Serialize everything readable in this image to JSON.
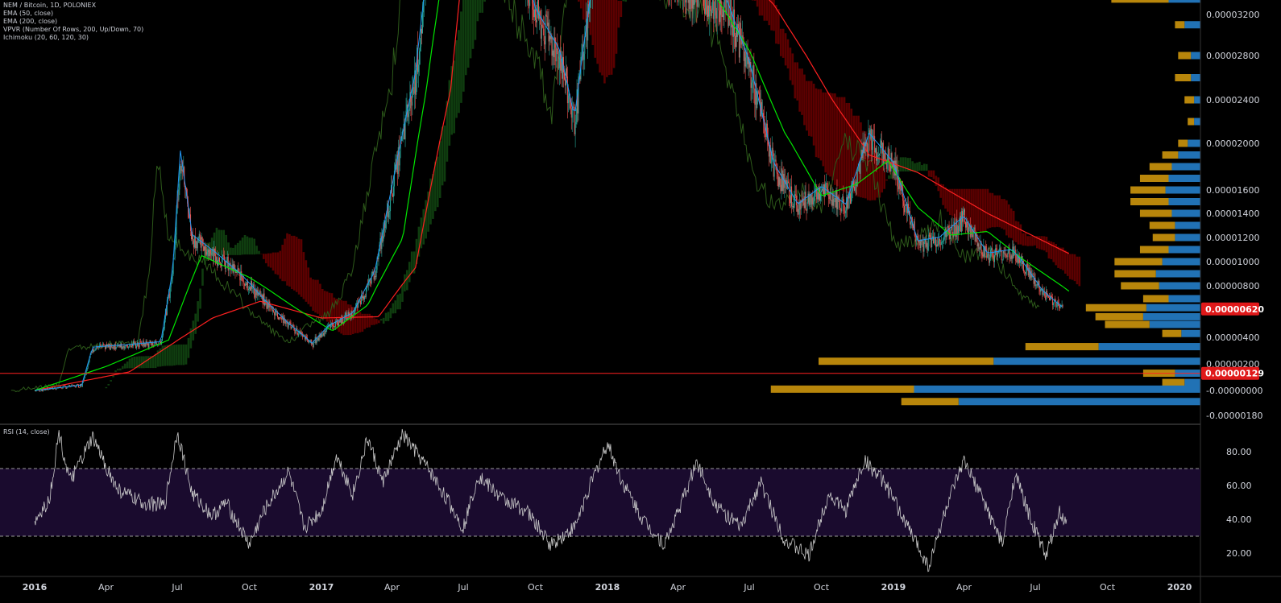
{
  "legend": {
    "symbol": "NEM / Bitcoin, 1D, POLONIEX",
    "ema50": "EMA (50, close)",
    "ema200": "EMA (200, close)",
    "vpvr": "VPVR (Number Of Rows, 200, Up/Down, 70)",
    "ichimoku": "Ichimoku (20, 60, 120, 30)",
    "rsi": "RSI (14, close)"
  },
  "colors": {
    "background": "#000000",
    "candle_up": "#26a69a",
    "candle_down": "#ef5350",
    "ema50": "#00e600",
    "ema200": "#ff2020",
    "tenkan": "#2196f3",
    "kumo_bear": "#5c0000",
    "kumo_bull": "#0f3d0f",
    "chikou": "#2d5a1a",
    "vpvr_up": "#2172b5",
    "vpvr_down": "#b8860b",
    "rsi_line": "#c8c8c8",
    "rsi_band": "#1a0b2e",
    "price_badge": "#e0191a"
  },
  "chart_data": [
    {
      "type": "candlestick",
      "pair": "NEM / Bitcoin",
      "interval": "1D",
      "exchange": "POLONIEX",
      "x_tick_labels": [
        "2016",
        "Apr",
        "Jul",
        "Oct",
        "2017",
        "Apr",
        "Jul",
        "Oct",
        "2018",
        "Apr",
        "Jul",
        "Oct",
        "2019",
        "Apr",
        "Jul",
        "Oct",
        "2020"
      ],
      "y_tick_labels": [
        "0.00003200",
        "0.00002800",
        "0.00002400",
        "0.00002000",
        "0.00001600",
        "0.00001400",
        "0.00001200",
        "0.00001000",
        "0.00000800",
        "0.00000400",
        "0.00000200",
        "-0.00000000",
        "-0.00000180"
      ],
      "y_tick_values": [
        3.2e-05,
        2.8e-05,
        2.4e-05,
        2e-05,
        1.6e-05,
        1.4e-05,
        1.2e-05,
        1e-05,
        8e-06,
        4e-06,
        2e-06,
        0,
        -1.8e-06
      ],
      "last_price_label": "0.00000620",
      "last_price": 6.2e-06,
      "horizontal_line_label": "0.00000129",
      "horizontal_line": 1.29e-06,
      "close_path": [
        [
          "2016-01-01",
          0.0
        ],
        [
          "2016-03-01",
          4e-07
        ],
        [
          "2016-03-15",
          3.2e-06
        ],
        [
          "2016-05-01",
          3.4e-06
        ],
        [
          "2016-06-10",
          3.6e-06
        ],
        [
          "2016-06-25",
          9e-06
        ],
        [
          "2016-07-05",
          1.9e-05
        ],
        [
          "2016-07-20",
          1.2e-05
        ],
        [
          "2016-08-20",
          1.05e-05
        ],
        [
          "2016-09-20",
          8.8e-06
        ],
        [
          "2016-10-20",
          6.8e-06
        ],
        [
          "2016-11-20",
          5e-06
        ],
        [
          "2016-12-20",
          3.5e-06
        ],
        [
          "2017-01-10",
          4.8e-06
        ],
        [
          "2017-02-10",
          5.8e-06
        ],
        [
          "2017-03-10",
          9e-06
        ],
        [
          "2017-04-01",
          1.6e-05
        ],
        [
          "2017-05-01",
          2.6e-05
        ],
        [
          "2017-05-15",
          3.5e-05
        ],
        [
          "2017-07-01",
          6e-05
        ],
        [
          "2017-10-01",
          3.2e-05
        ],
        [
          "2017-11-01",
          2.8e-05
        ],
        [
          "2017-11-20",
          2.2e-05
        ],
        [
          "2017-12-10",
          3.3e-05
        ],
        [
          "2018-01-10",
          6e-05
        ],
        [
          "2018-03-15",
          3.6e-05
        ],
        [
          "2018-05-01",
          3.4e-05
        ],
        [
          "2018-06-01",
          3.3e-05
        ],
        [
          "2018-07-01",
          2.7e-05
        ],
        [
          "2018-08-01",
          1.8e-05
        ],
        [
          "2018-09-01",
          1.45e-05
        ],
        [
          "2018-10-01",
          1.6e-05
        ],
        [
          "2018-11-01",
          1.45e-05
        ],
        [
          "2018-12-01",
          2.05e-05
        ],
        [
          "2019-01-01",
          1.8e-05
        ],
        [
          "2019-02-01",
          1.15e-05
        ],
        [
          "2019-03-01",
          1.18e-05
        ],
        [
          "2019-04-01",
          1.35e-05
        ],
        [
          "2019-05-01",
          1.05e-05
        ],
        [
          "2019-06-01",
          1.08e-05
        ],
        [
          "2019-06-15",
          9.8e-06
        ],
        [
          "2019-07-10",
          7.5e-06
        ],
        [
          "2019-08-05",
          6.2e-06
        ]
      ],
      "ema50_path": [
        [
          "2016-01-01",
          0.0
        ],
        [
          "2016-04-01",
          1.8e-06
        ],
        [
          "2016-06-20",
          3.8e-06
        ],
        [
          "2016-08-01",
          1.05e-05
        ],
        [
          "2016-10-01",
          8.7e-06
        ],
        [
          "2016-12-01",
          6.2e-06
        ],
        [
          "2017-01-15",
          4.5e-06
        ],
        [
          "2017-03-01",
          6.5e-06
        ],
        [
          "2017-04-15",
          1.2e-05
        ],
        [
          "2017-05-15",
          2.5e-05
        ],
        [
          "2017-07-01",
          5e-05
        ],
        [
          "2018-05-01",
          3.6e-05
        ],
        [
          "2018-07-01",
          2.85e-05
        ],
        [
          "2018-08-15",
          2.1e-05
        ],
        [
          "2018-10-01",
          1.55e-05
        ],
        [
          "2018-11-15",
          1.65e-05
        ],
        [
          "2018-12-25",
          1.85e-05
        ],
        [
          "2019-02-01",
          1.45e-05
        ],
        [
          "2019-03-15",
          1.22e-05
        ],
        [
          "2019-05-01",
          1.25e-05
        ],
        [
          "2019-06-15",
          1.02e-05
        ],
        [
          "2019-08-15",
          7.5e-06
        ]
      ],
      "ema200_path": [
        [
          "2016-01-01",
          0.0
        ],
        [
          "2016-05-01",
          1.4e-06
        ],
        [
          "2016-08-15",
          5.5e-06
        ],
        [
          "2016-10-15",
          6.8e-06
        ],
        [
          "2017-01-01",
          5.5e-06
        ],
        [
          "2017-03-15",
          5.6e-06
        ],
        [
          "2017-05-01",
          9.5e-06
        ],
        [
          "2017-06-15",
          2.5e-05
        ],
        [
          "2017-07-15",
          4.8e-05
        ],
        [
          "2018-05-01",
          4e-05
        ],
        [
          "2018-08-01",
          3.3e-05
        ],
        [
          "2018-10-15",
          2.4e-05
        ],
        [
          "2018-12-01",
          1.9e-05
        ],
        [
          "2019-02-01",
          1.75e-05
        ],
        [
          "2019-05-01",
          1.4e-05
        ],
        [
          "2019-08-15",
          1.06e-05
        ]
      ],
      "rsi": {
        "period": 14,
        "y_tick_labels": [
          "80.00",
          "60.00",
          "40.00",
          "20.00"
        ],
        "y_tick_values": [
          80,
          60,
          40,
          20
        ],
        "overbought": 70,
        "oversold": 30,
        "path": [
          [
            "2016-01-01",
            38
          ],
          [
            "2016-01-20",
            52
          ],
          [
            "2016-02-01",
            91
          ],
          [
            "2016-02-15",
            62
          ],
          [
            "2016-03-15",
            88
          ],
          [
            "2016-04-15",
            58
          ],
          [
            "2016-05-15",
            50
          ],
          [
            "2016-06-15",
            48
          ],
          [
            "2016-07-01",
            92
          ],
          [
            "2016-07-20",
            55
          ],
          [
            "2016-08-15",
            42
          ],
          [
            "2016-09-01",
            50
          ],
          [
            "2016-10-01",
            25
          ],
          [
            "2016-10-20",
            45
          ],
          [
            "2016-11-20",
            68
          ],
          [
            "2016-12-10",
            35
          ],
          [
            "2017-01-01",
            45
          ],
          [
            "2017-01-20",
            78
          ],
          [
            "2017-02-10",
            55
          ],
          [
            "2017-03-01",
            88
          ],
          [
            "2017-03-20",
            62
          ],
          [
            "2017-04-15",
            90
          ],
          [
            "2017-05-20",
            68
          ],
          [
            "2017-06-15",
            48
          ],
          [
            "2017-07-01",
            35
          ],
          [
            "2017-07-20",
            66
          ],
          [
            "2017-08-20",
            52
          ],
          [
            "2017-09-20",
            45
          ],
          [
            "2017-10-20",
            25
          ],
          [
            "2017-11-20",
            35
          ],
          [
            "2017-12-10",
            60
          ],
          [
            "2018-01-01",
            85
          ],
          [
            "2018-01-20",
            62
          ],
          [
            "2018-02-15",
            40
          ],
          [
            "2018-03-15",
            25
          ],
          [
            "2018-04-10",
            55
          ],
          [
            "2018-04-25",
            74
          ],
          [
            "2018-05-20",
            48
          ],
          [
            "2018-06-20",
            35
          ],
          [
            "2018-07-15",
            62
          ],
          [
            "2018-08-15",
            28
          ],
          [
            "2018-09-15",
            18
          ],
          [
            "2018-10-10",
            55
          ],
          [
            "2018-11-01",
            45
          ],
          [
            "2018-11-25",
            75
          ],
          [
            "2018-12-20",
            62
          ],
          [
            "2019-01-20",
            35
          ],
          [
            "2019-02-15",
            12
          ],
          [
            "2019-03-10",
            48
          ],
          [
            "2019-04-01",
            74
          ],
          [
            "2019-04-25",
            52
          ],
          [
            "2019-05-20",
            25
          ],
          [
            "2019-06-05",
            67
          ],
          [
            "2019-06-25",
            40
          ],
          [
            "2019-07-15",
            18
          ],
          [
            "2019-08-01",
            44
          ],
          [
            "2019-08-10",
            36
          ]
        ]
      },
      "vpvr_rows": [
        {
          "price": 3.35e-05,
          "up": 0.1,
          "down": 0.18
        },
        {
          "price": 3.1e-05,
          "up": 0.05,
          "down": 0.03
        },
        {
          "price": 2.8e-05,
          "up": 0.03,
          "down": 0.04
        },
        {
          "price": 2.6e-05,
          "up": 0.03,
          "down": 0.05
        },
        {
          "price": 2.4e-05,
          "up": 0.02,
          "down": 0.03
        },
        {
          "price": 2.2e-05,
          "up": 0.02,
          "down": 0.02
        },
        {
          "price": 2e-05,
          "up": 0.04,
          "down": 0.03
        },
        {
          "price": 1.9e-05,
          "up": 0.07,
          "down": 0.05
        },
        {
          "price": 1.8e-05,
          "up": 0.09,
          "down": 0.07
        },
        {
          "price": 1.7e-05,
          "up": 0.1,
          "down": 0.09
        },
        {
          "price": 1.6e-05,
          "up": 0.11,
          "down": 0.11
        },
        {
          "price": 1.5e-05,
          "up": 0.1,
          "down": 0.12
        },
        {
          "price": 1.4e-05,
          "up": 0.09,
          "down": 0.1
        },
        {
          "price": 1.3e-05,
          "up": 0.08,
          "down": 0.08
        },
        {
          "price": 1.2e-05,
          "up": 0.08,
          "down": 0.07
        },
        {
          "price": 1.1e-05,
          "up": 0.1,
          "down": 0.09
        },
        {
          "price": 1e-05,
          "up": 0.12,
          "down": 0.15
        },
        {
          "price": 9e-06,
          "up": 0.14,
          "down": 0.13
        },
        {
          "price": 8e-06,
          "up": 0.13,
          "down": 0.12
        },
        {
          "price": 7e-06,
          "up": 0.1,
          "down": 0.08
        },
        {
          "price": 6.3e-06,
          "up": 0.17,
          "down": 0.19
        },
        {
          "price": 5.6e-06,
          "up": 0.18,
          "down": 0.15
        },
        {
          "price": 5e-06,
          "up": 0.16,
          "down": 0.14
        },
        {
          "price": 4.3e-06,
          "up": 0.06,
          "down": 0.06
        },
        {
          "price": 3.3e-06,
          "up": 0.32,
          "down": 0.23
        },
        {
          "price": 2.2e-06,
          "up": 0.65,
          "down": 0.55
        },
        {
          "price": 1.3e-06,
          "up": 0.08,
          "down": 0.1
        },
        {
          "price": 6e-07,
          "up": 0.05,
          "down": 0.07
        },
        {
          "price": 1e-07,
          "up": 0.9,
          "down": 0.45
        },
        {
          "price": -8e-07,
          "up": 0.76,
          "down": 0.18
        }
      ]
    }
  ]
}
